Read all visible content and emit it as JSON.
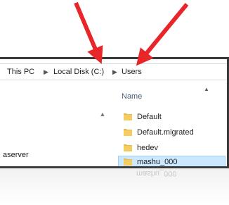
{
  "breadcrumb": {
    "items": [
      "This PC",
      "Local Disk (C:)",
      "Users"
    ],
    "separator": "▶"
  },
  "navigation_pane": {
    "visible_items": [
      "aserver",
      "aserver"
    ]
  },
  "file_list": {
    "column_header": "Name",
    "sort_indicator": "▲",
    "folders": [
      "Default",
      "Default.migrated",
      "hedev",
      "mashu_000"
    ],
    "selected_index": 3
  },
  "reflection": {
    "text": "mashu_000"
  },
  "colors": {
    "arrow": "#e8262a",
    "selection_fill": "#cce8ff",
    "selection_border": "#99d1ff",
    "folder": "#e8b94a",
    "window_border": "#3a3a3a"
  }
}
